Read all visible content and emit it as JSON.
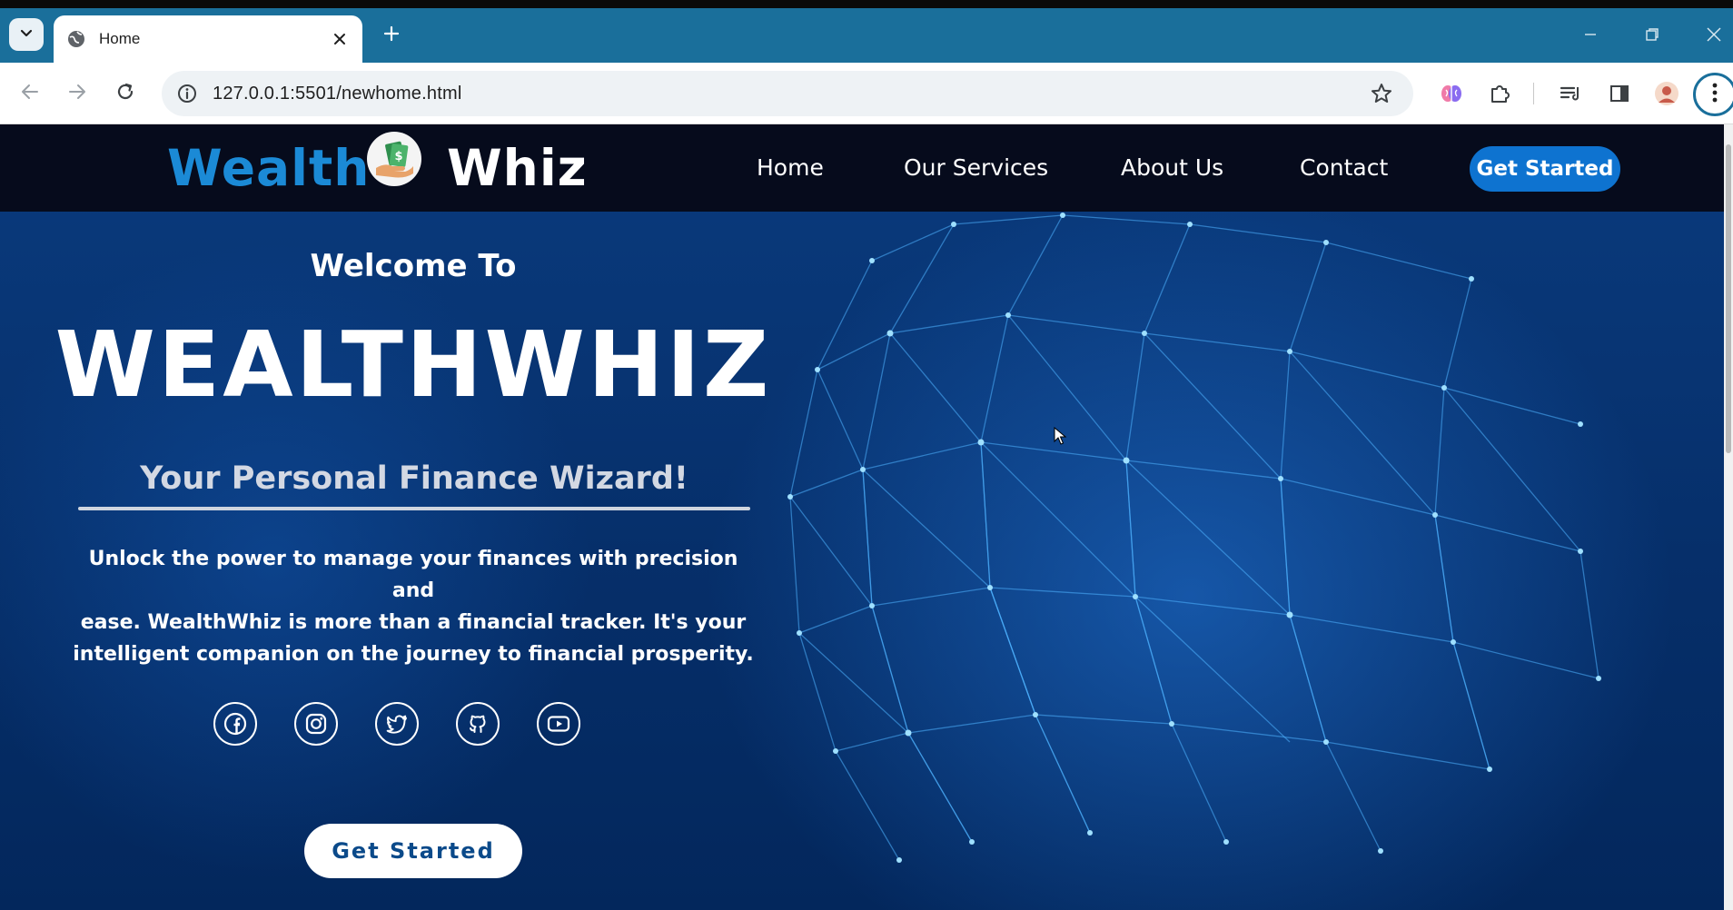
{
  "browser": {
    "tab_title": "Home",
    "url": "127.0.0.1:5501/newhome.html",
    "accent": "#1a6f9b"
  },
  "icons": {
    "tab_search": "chevron-down-icon",
    "tab_favicon": "globe-icon",
    "tab_close": "close-icon",
    "new_tab": "plus-icon",
    "back": "arrow-left-icon",
    "forward": "arrow-right-icon",
    "reload": "reload-icon",
    "site_info": "info-icon",
    "bookmark": "star-icon",
    "extensions": [
      "brain-extension-icon",
      "puzzle-icon",
      "reading-list-icon",
      "side-panel-icon",
      "profile-avatar-icon"
    ],
    "menu": "more-vert-icon",
    "socials": [
      "facebook-icon",
      "instagram-icon",
      "twitter-icon",
      "github-icon",
      "youtube-icon"
    ]
  },
  "site": {
    "logo": {
      "word1": "Wealth",
      "word2": "Whiz"
    },
    "nav": {
      "items": [
        {
          "label": "Home"
        },
        {
          "label": "Our Services"
        },
        {
          "label": "About Us"
        },
        {
          "label": "Contact"
        }
      ],
      "cta": "Get Started"
    },
    "hero": {
      "welcome": "Welcome To",
      "brand": "WEALTHWHIZ",
      "tagline": "Your Personal Finance Wizard!",
      "desc_line1": "Unlock the power to manage your finances with precision and",
      "desc_line2": "ease. WealthWhiz is more than a financial tracker. It's your",
      "desc_line3": "intelligent companion on the journey to financial prosperity.",
      "cta": "Get Started"
    },
    "colors": {
      "navbar": "#060b1c",
      "logo_blue": "#1b8ad6",
      "cta_blue": "#0e73d0",
      "hero_bg": "#062d66"
    }
  }
}
